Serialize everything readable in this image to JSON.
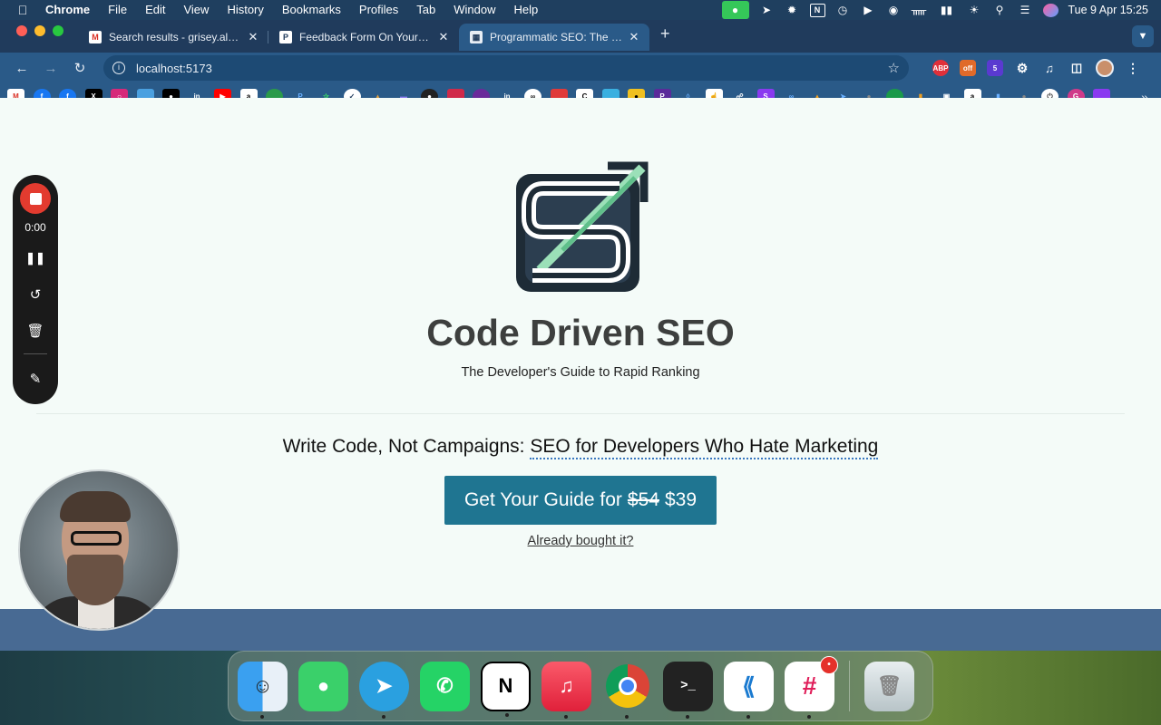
{
  "menubar": {
    "app_name": "Chrome",
    "menus": [
      "File",
      "Edit",
      "View",
      "History",
      "Bookmarks",
      "Profiles",
      "Tab",
      "Window",
      "Help"
    ],
    "clock": "Tue 9 Apr  15:25",
    "tray_icons": [
      "facetime-icon",
      "telegram-icon",
      "settings-icon",
      "notion-icon",
      "clock-icon",
      "play-icon",
      "airpods-icon",
      "bluetooth-icon",
      "battery-icon",
      "wifi-icon",
      "search-icon",
      "control-center-icon",
      "siri-icon"
    ]
  },
  "tabs": [
    {
      "title": "Search results - grisey.alexan",
      "favicon": "gmail-icon",
      "active": false
    },
    {
      "title": "Feedback Form On Your Webs",
      "favicon": "feedback-icon",
      "active": false
    },
    {
      "title": "Programmatic SEO: The Deve",
      "favicon": "seo-icon",
      "active": true
    }
  ],
  "toolbar": {
    "url": "localhost:5173",
    "extensions": [
      "ABP",
      "off",
      "5"
    ]
  },
  "page": {
    "brand_title": "Code Driven SEO",
    "tagline": "The Developer's Guide to Rapid Ranking",
    "headline_part1": "Write Code, Not Campaigns: ",
    "headline_part2": "SEO for Developers Who Hate Marketing",
    "cta_prefix": "Get Your Guide for",
    "cta_old_price": "$54",
    "cta_new_price": "$39",
    "already_bought": "Already bought it?"
  },
  "recorder": {
    "time": "0:00"
  },
  "dock": {
    "apps": [
      {
        "name": "finder",
        "badge": ""
      },
      {
        "name": "messages",
        "badge": ""
      },
      {
        "name": "telegram",
        "badge": ""
      },
      {
        "name": "whatsapp",
        "badge": ""
      },
      {
        "name": "notion",
        "badge": ""
      },
      {
        "name": "music",
        "badge": ""
      },
      {
        "name": "chrome",
        "badge": ""
      },
      {
        "name": "terminal",
        "badge": ""
      },
      {
        "name": "vscode",
        "badge": ""
      },
      {
        "name": "slack",
        "badge": "•"
      },
      {
        "name": "trash",
        "badge": ""
      }
    ]
  },
  "colors": {
    "cta_bg": "#1f7591",
    "page_bg": "#f4fbf8",
    "tab_active": "#2a5a88",
    "tabstrip": "#203b5c"
  }
}
